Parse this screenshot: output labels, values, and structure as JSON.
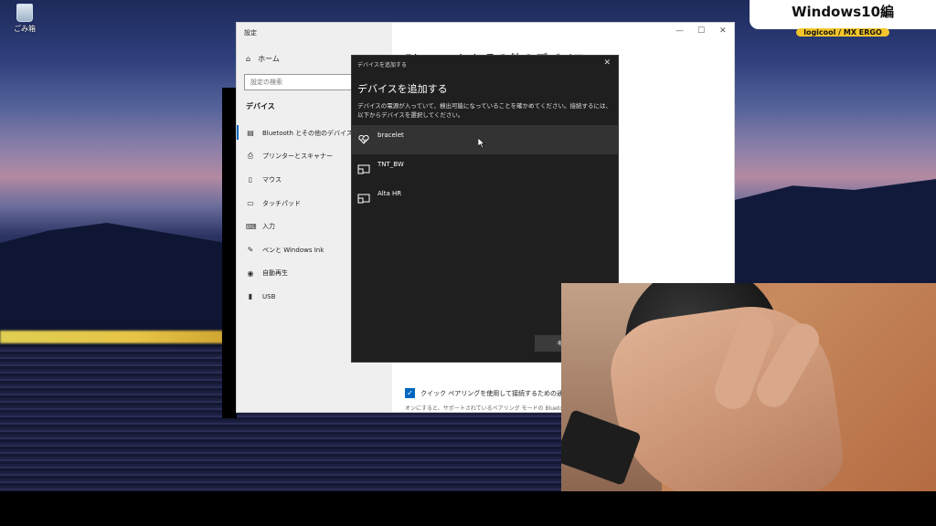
{
  "desktop": {
    "recycle_bin_label": "ごみ箱"
  },
  "badge": {
    "title": "Windows10編",
    "subtitle": "logicool / MX ERGO"
  },
  "settings": {
    "window_title": "設定",
    "home_label": "ホーム",
    "search_placeholder": "設定の検索",
    "section_title": "デバイス",
    "nav_items": [
      {
        "label": "Bluetooth とその他のデバイス",
        "icon": "bluetooth-devices-icon"
      },
      {
        "label": "プリンターとスキャナー",
        "icon": "printer-icon"
      },
      {
        "label": "マウス",
        "icon": "mouse-icon"
      },
      {
        "label": "タッチパッド",
        "icon": "touchpad-icon"
      },
      {
        "label": "入力",
        "icon": "keyboard-icon"
      },
      {
        "label": "ペンと Windows Ink",
        "icon": "pen-icon"
      },
      {
        "label": "自動再生",
        "icon": "autoplay-icon"
      },
      {
        "label": "USB",
        "icon": "usb-icon"
      }
    ],
    "page_heading": "Bluetooth とその他のデバイス",
    "quick_pair_label": "クイック ペアリングを使用して接続するための通知を表",
    "quick_pair_desc": "オンにすると、サポートされているペアリング モードの Bluetooth"
  },
  "dialog": {
    "window_title": "デバイスを追加する",
    "heading": "デバイスを追加する",
    "description": "デバイスの電源が入っていて、検出可能になっていることを確かめてください。接続するには、以下からデバイスを選択してください。",
    "devices": [
      {
        "name": "bracelet",
        "icon": "heart-rate-icon"
      },
      {
        "name": "TNT_BW",
        "icon": "display-device-icon"
      },
      {
        "name": "Alta HR",
        "icon": "display-device-icon"
      }
    ],
    "button_label": "キ"
  }
}
